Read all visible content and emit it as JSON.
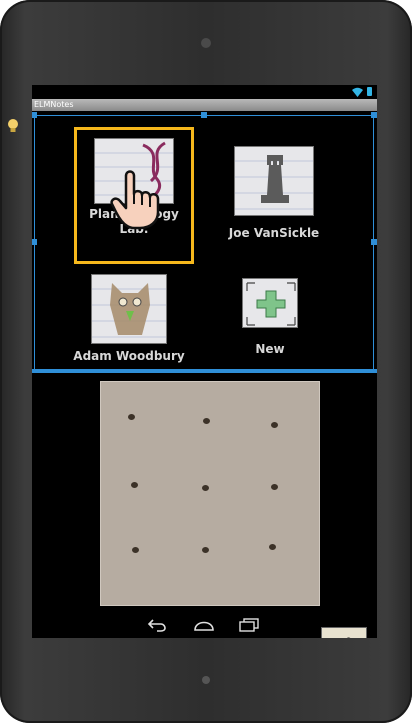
{
  "app": {
    "title": "ELMNotes"
  },
  "contacts": [
    {
      "name": "Plant Biology Lab.",
      "name_line1": "Plant Biology",
      "name_line2": "Lab.",
      "icon": "dna-strand-icon"
    },
    {
      "name": "Joe VanSickle",
      "icon": "rook-chess-icon"
    },
    {
      "name": "Adam Woodbury",
      "icon": "owl-drawing-icon"
    },
    {
      "name": "New",
      "icon": "add-plus-icon"
    }
  ],
  "board": {
    "rows": 3,
    "columns": 3,
    "peg_count": 9
  },
  "side_items": {
    "left": {
      "icon": "scribble-drawing-icon"
    },
    "right": {
      "icon": "thumbs-up-icon"
    }
  },
  "nav": {
    "back_icon": "back-arrow-icon",
    "home_icon": "home-icon",
    "recents_icon": "recent-apps-icon"
  },
  "colors": {
    "accent": "#2f8fd8",
    "focus": "#f6b81c",
    "status_battery": "#33b5e5",
    "background": "#000000"
  }
}
